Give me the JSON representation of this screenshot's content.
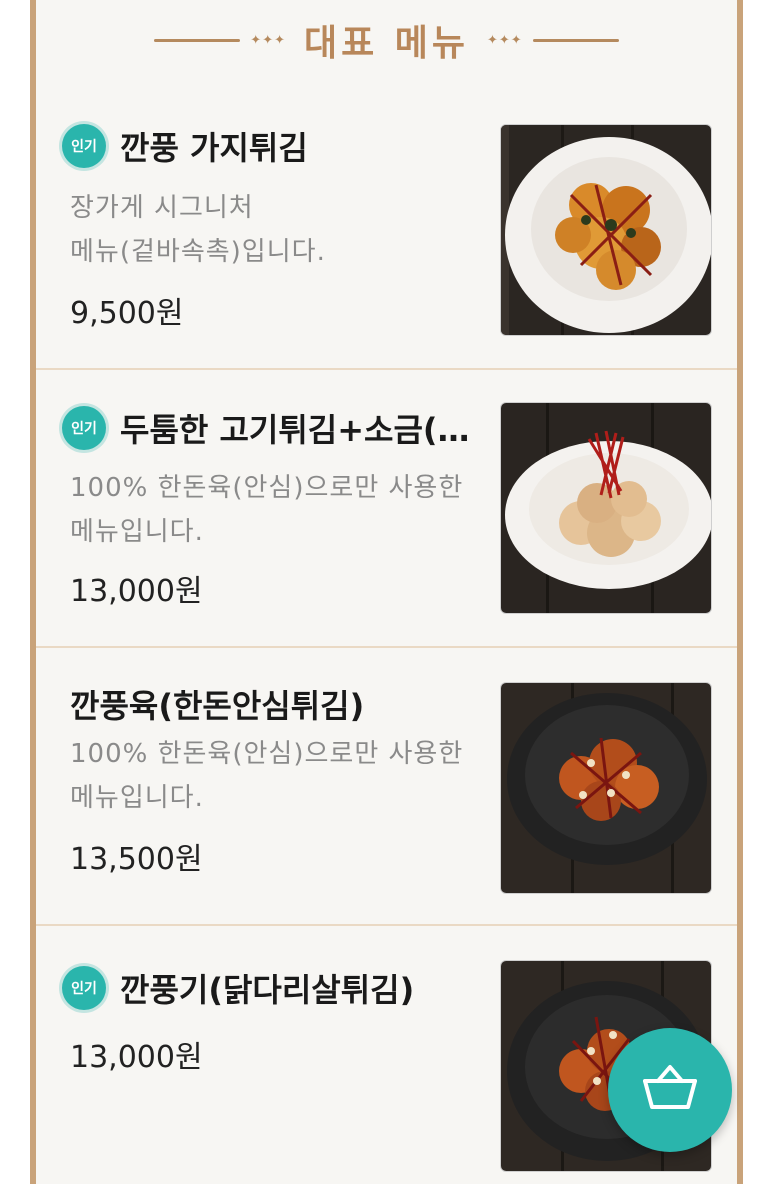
{
  "header": {
    "title": "대표 메뉴",
    "diamonds": "✦✦✦"
  },
  "items": [
    {
      "badge": "인기",
      "name": "깐풍 가지튀김",
      "desc_line1": "장가게 시그니처",
      "desc_line2": "메뉴(겉바속촉)입니다.",
      "price": "9,500원"
    },
    {
      "badge": "인기",
      "name": "두툼한 고기튀김+소금(...",
      "desc_line1": "100% 한돈육(안심)으로만 사용한",
      "desc_line2": "메뉴입니다.",
      "price": "13,000원"
    },
    {
      "badge": "",
      "name": "깐풍육(한돈안심튀김)",
      "desc_line1": "100% 한돈육(안심)으로만 사용한",
      "desc_line2": "메뉴입니다.",
      "price": "13,500원"
    },
    {
      "badge": "인기",
      "name": "깐풍기(닭다리살튀김)",
      "desc_line1": "",
      "desc_line2": "",
      "price": "13,000원"
    }
  ],
  "cart": {
    "icon": "shopping-basket-icon"
  },
  "colors": {
    "accent": "#2ab5ac",
    "border": "#c9a37a",
    "title": "#b8875a"
  }
}
